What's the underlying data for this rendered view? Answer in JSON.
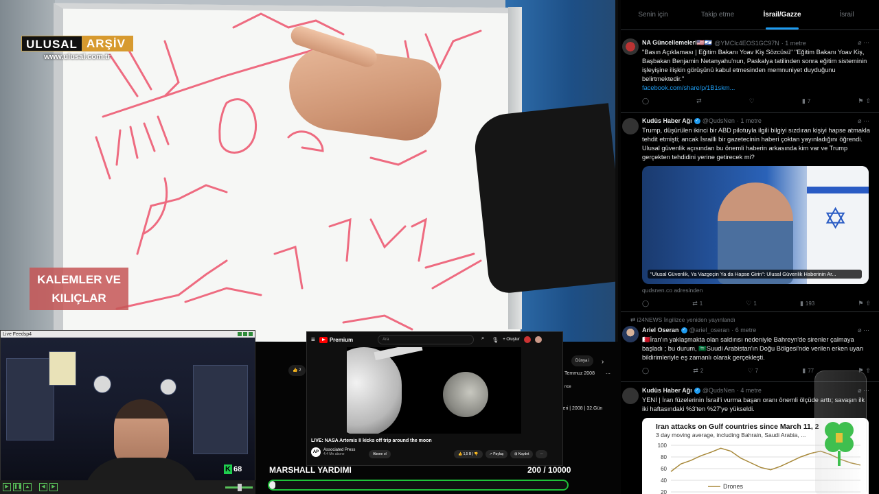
{
  "main_video": {
    "logo_left": "ULUSAL",
    "logo_right": "ARŞİV",
    "logo_url": "www.ulusal.com.tr",
    "program_title_line1": "KALEMLER VE",
    "program_title_line2": "KILIÇLAR"
  },
  "live_feed": {
    "window_title": "Live Feeds​p4",
    "kick_count": "68"
  },
  "youtube": {
    "brand": "Premium",
    "search_placeholder": "Ara",
    "create_label": "Oluştur",
    "video_title": "LIVE: NASA Artemis II kicks off trip around the moon",
    "channel_name": "Associated Press",
    "channel_subs": "4.4 Mn abone",
    "subscribe_label": "Abone ol",
    "like_count": "1,5 B",
    "share_label": "Paylaş",
    "save_label": "Kaydet",
    "bg_chip": "Dünya i",
    "bg_like": "2",
    "bg_date": "Temmuz 2008",
    "bg_since": "nce",
    "bg_meta": "leri | 2008 | 32.Gün"
  },
  "goal": {
    "label": "MARSHALL YARDIMI",
    "count": "200 / 10000",
    "progress": 0.02
  },
  "twitter": {
    "tabs": [
      "Senin için",
      "Takip etme",
      "İsrail/Gazze",
      "İsrail"
    ],
    "active_tab": 2,
    "tweet1": {
      "name": "NA Güncellemeleri🇺🇸🇮🇱",
      "handle": "@YMClc4EOS1GC97N",
      "time": "· 1 metre",
      "text": "\"Basın Açıklaması | Eğitim Bakanı Yoav Kiş Sözcüsü\" \"Eğitim Bakanı Yoav Kiş, Başbakan Benjamin Netanyahu'nun, Paskalya tatilinden sonra eğitim sisteminin işleyişine ilişkin görüşünü kabul etmesinden memnuniyet duyduğunu belirtmektedir.\"",
      "link": "facebook.com/share/p/1B1skm...",
      "views": "7"
    },
    "tweet2": {
      "name": "Kudüs Haber Ağı",
      "handle": "@QudsNen",
      "time": "· 1 metre",
      "text": "Trump, düşürülen ikinci bir ABD pilotuyla ilgili bilgiyi sızdıran kişiyi hapse atmakla tehdit etmişti; ancak İsrailli bir gazetecinin haberi çoktan yayınladığını öğrendi. Ulusal güvenlik açısından bu önemli haberin arkasında kim var ve Trump gerçekten tehdidini yerine getirecek mi?",
      "card_caption": "\"Ulusal Güvenlik, Ya Vazgeçin Ya da Hapse Girin\": Ulusal Güvenlik Haberinin Ar...",
      "card_source": "qudsnen.co adresinden",
      "replies": "",
      "reposts": "1",
      "likes": "1",
      "views": "193"
    },
    "tweet3": {
      "repost_line": "i24NEWS İngilizce yeniden yayınlandı",
      "name": "Ariel Oseran",
      "handle": "@ariel_oseran",
      "time": "· 6 metre",
      "text": "🇧🇭İran'ın yaklaşmakta olan saldırısı nedeniyle Bahreyn'de sirenler çalmaya başladı ; bu durum, 🇸🇦Suudi Arabistan'ın Doğu Bölgesi'nde verilen erken uyarı bildirimleriyle eş zamanlı olarak gerçekleşti.",
      "reposts": "2",
      "likes": "7",
      "views": "77"
    },
    "tweet4": {
      "name": "Kudüs Haber Ağı",
      "handle": "@QudsNen",
      "time": "· 4 metre",
      "text": "YENİ | İran füzelerinin İsrail'i vurma başarı oranı önemli ölçüde arttı; savaşın ilk iki haftasındaki %3'ten %27'ye yükseldi."
    }
  },
  "chart_data": {
    "type": "line",
    "title": "Iran attacks on Gulf countries since March 11, 2",
    "subtitle": "3 day moving average, including Bahrain, Saudi Arabia, ...",
    "yticks": [
      100,
      80,
      60,
      40,
      20
    ],
    "ylim": [
      20,
      100
    ],
    "series": [
      {
        "name": "Drones",
        "values": [
          55,
          68,
          74,
          82,
          88,
          95,
          90,
          78,
          70,
          62,
          58,
          64,
          72,
          80,
          86,
          90,
          84,
          76,
          70,
          66
        ]
      }
    ]
  }
}
